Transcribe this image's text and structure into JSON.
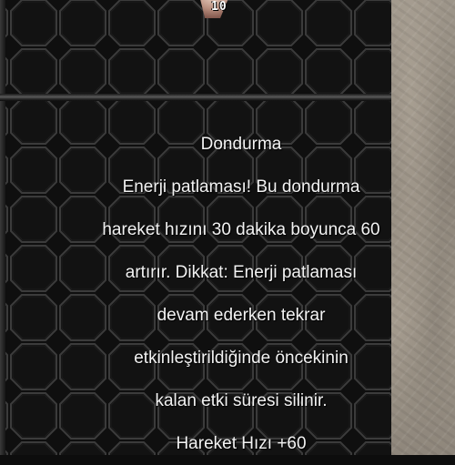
{
  "item": {
    "stack_count": "10",
    "name": "Dondurma",
    "description_lines": [
      "Enerji patlaması! Bu dondurma",
      "hareket hızını 30 dakika boyunca 60",
      "artırır. Dikkat: Enerji patlaması",
      "devam ederken tekrar",
      "etkinleştirildiğinde öncekinin",
      "kalan etki süresi silinir."
    ],
    "bonus_line": "Hareket Hızı +60"
  },
  "colors": {
    "text": "#f2f2f2",
    "background": "#0d0d0d",
    "grid_line": "#3a3a3a"
  }
}
